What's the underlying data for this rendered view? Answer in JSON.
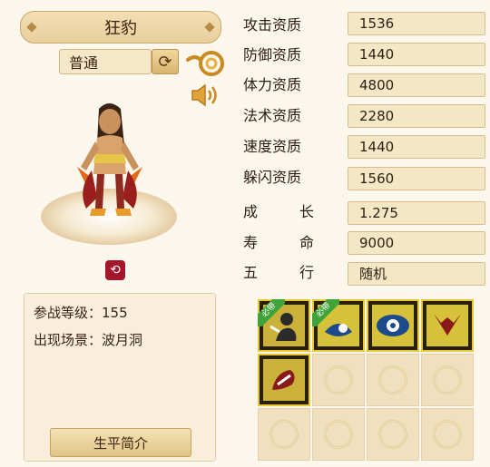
{
  "pet": {
    "name": "狂豹",
    "variant": "普通"
  },
  "info": {
    "level_label": "参战等级：",
    "level_value": "155",
    "scene_label": "出现场景：",
    "scene_value": "波月洞",
    "bio_button": "生平简介"
  },
  "stats": [
    {
      "label": "攻击资质",
      "value": "1536"
    },
    {
      "label": "防御资质",
      "value": "1440"
    },
    {
      "label": "体力资质",
      "value": "4800"
    },
    {
      "label": "法术资质",
      "value": "2280"
    },
    {
      "label": "速度资质",
      "value": "1440"
    },
    {
      "label": "躲闪资质",
      "value": "1560"
    },
    {
      "label_chars": [
        "成",
        "长"
      ],
      "value": "1.275"
    },
    {
      "label_chars": [
        "寿",
        "命"
      ],
      "value": "9000"
    },
    {
      "label_chars": [
        "五",
        "行"
      ],
      "value": "随机"
    }
  ],
  "skills": {
    "required_badge": "必带",
    "icons": [
      {
        "name": "skill-icon-1",
        "required": true
      },
      {
        "name": "skill-icon-2",
        "required": true
      },
      {
        "name": "skill-icon-3",
        "required": false
      },
      {
        "name": "skill-icon-4",
        "required": false
      },
      {
        "name": "skill-icon-5",
        "required": false
      }
    ]
  },
  "colors": {
    "background": "#fcf7ec",
    "skill_border": "#e8c830",
    "badge_green": "#3fa33a",
    "return_red": "#a6162b"
  }
}
